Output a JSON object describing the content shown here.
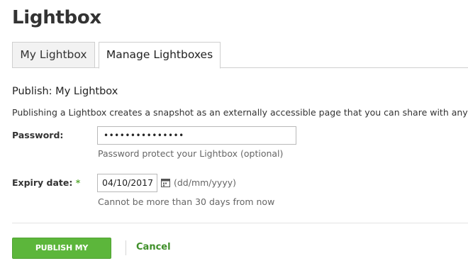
{
  "page": {
    "title": "Lightbox"
  },
  "tabs": [
    {
      "label": "My Lightbox",
      "active": false
    },
    {
      "label": "Manage Lightboxes",
      "active": true
    }
  ],
  "form": {
    "section_title": "Publish: My Lightbox",
    "description": "Publishing a Lightbox creates a snapshot as an externally accessible page that you can share with anyone.",
    "password": {
      "label": "Password:",
      "value": "•••••••••••••••",
      "hint": "Password protect your Lightbox (optional)"
    },
    "expiry": {
      "label": "Expiry date:",
      "required_marker": "*",
      "value": "04/10/2017",
      "format": "(dd/mm/yyyy)",
      "hint": "Cannot be more than 30 days from now"
    }
  },
  "actions": {
    "publish_label": "PUBLISH MY LIGHTBOX",
    "cancel_label": "Cancel"
  },
  "icons": {
    "date_picker": "calendar-icon"
  },
  "colors": {
    "accent": "#5cb63b",
    "link": "#3f8f2a",
    "required": "#5cad37"
  }
}
